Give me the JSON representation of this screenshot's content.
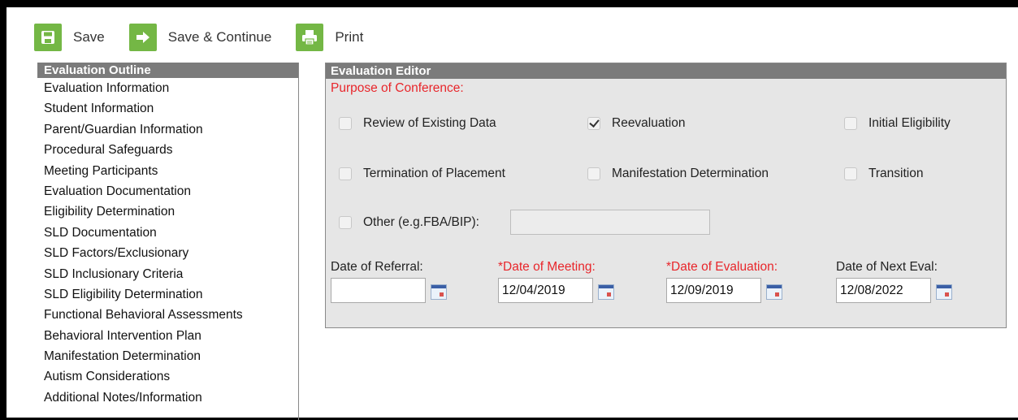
{
  "toolbar": {
    "save_label": "Save",
    "save_continue_label": "Save & Continue",
    "print_label": "Print",
    "accent_color": "#74b745"
  },
  "outline": {
    "header": "Evaluation Outline",
    "items": [
      "Evaluation Information",
      "Student Information",
      "Parent/Guardian Information",
      "Procedural Safeguards",
      "Meeting Participants",
      "Evaluation Documentation",
      "Eligibility Determination",
      "SLD Documentation",
      "SLD Factors/Exclusionary",
      "SLD Inclusionary Criteria",
      "SLD Eligibility Determination",
      "Functional Behavioral Assessments",
      "Behavioral Intervention Plan",
      "Manifestation Determination",
      "Autism Considerations",
      "Additional Notes/Information"
    ]
  },
  "editor": {
    "header": "Evaluation Editor",
    "purpose_label": "Purpose of Conference:",
    "options": {
      "review": {
        "label": "Review of Existing Data",
        "checked": false
      },
      "reevaluation": {
        "label": "Reevaluation",
        "checked": true
      },
      "initial": {
        "label": "Initial Eligibility",
        "checked": false
      },
      "termination": {
        "label": "Termination of Placement",
        "checked": false
      },
      "manifestation": {
        "label": "Manifestation Determination",
        "checked": false
      },
      "transition": {
        "label": "Transition",
        "checked": false
      },
      "other": {
        "label": "Other (e.g.FBA/BIP):",
        "checked": false,
        "value": ""
      }
    },
    "dates": {
      "referral": {
        "label": "Date of Referral:",
        "value": ""
      },
      "meeting": {
        "label": "*Date of Meeting:",
        "value": "12/04/2019"
      },
      "evaluation": {
        "label": "*Date of Evaluation:",
        "value": "12/09/2019"
      },
      "next_eval": {
        "label": "Date of Next Eval:",
        "value": "12/08/2022"
      }
    },
    "required_color": "#e8262b"
  }
}
